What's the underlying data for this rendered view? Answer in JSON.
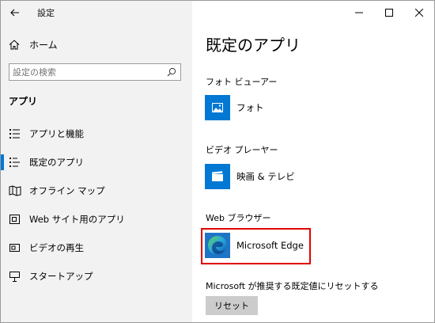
{
  "window": {
    "title": "設定"
  },
  "sidebar": {
    "home_label": "ホーム",
    "search": {
      "placeholder": "設定の検索",
      "value": ""
    },
    "section_title": "アプリ",
    "items": [
      {
        "label": "アプリと機能",
        "icon": "apps-features-icon",
        "active": false
      },
      {
        "label": "既定のアプリ",
        "icon": "default-apps-icon",
        "active": true
      },
      {
        "label": "オフライン マップ",
        "icon": "offline-maps-icon",
        "active": false
      },
      {
        "label": "Web サイト用のアプリ",
        "icon": "apps-for-websites-icon",
        "active": false
      },
      {
        "label": "ビデオの再生",
        "icon": "video-playback-icon",
        "active": false
      },
      {
        "label": "スタートアップ",
        "icon": "startup-icon",
        "active": false
      }
    ]
  },
  "content": {
    "page_title": "既定のアプリ",
    "categories": [
      {
        "label": "フォト ビューアー",
        "app": "フォト",
        "app_icon": "photos-icon"
      },
      {
        "label": "ビデオ プレーヤー",
        "app": "映画 & テレビ",
        "app_icon": "movies-tv-icon"
      },
      {
        "label": "Web ブラウザー",
        "app": "Microsoft Edge",
        "app_icon": "edge-icon"
      }
    ],
    "reset_text": "Microsoft が推奨する既定値にリセットする",
    "reset_button": "リセット"
  },
  "colors": {
    "accent": "#0078d4",
    "highlight": "#e00000",
    "sidebar_bg": "#f2f2f2"
  }
}
